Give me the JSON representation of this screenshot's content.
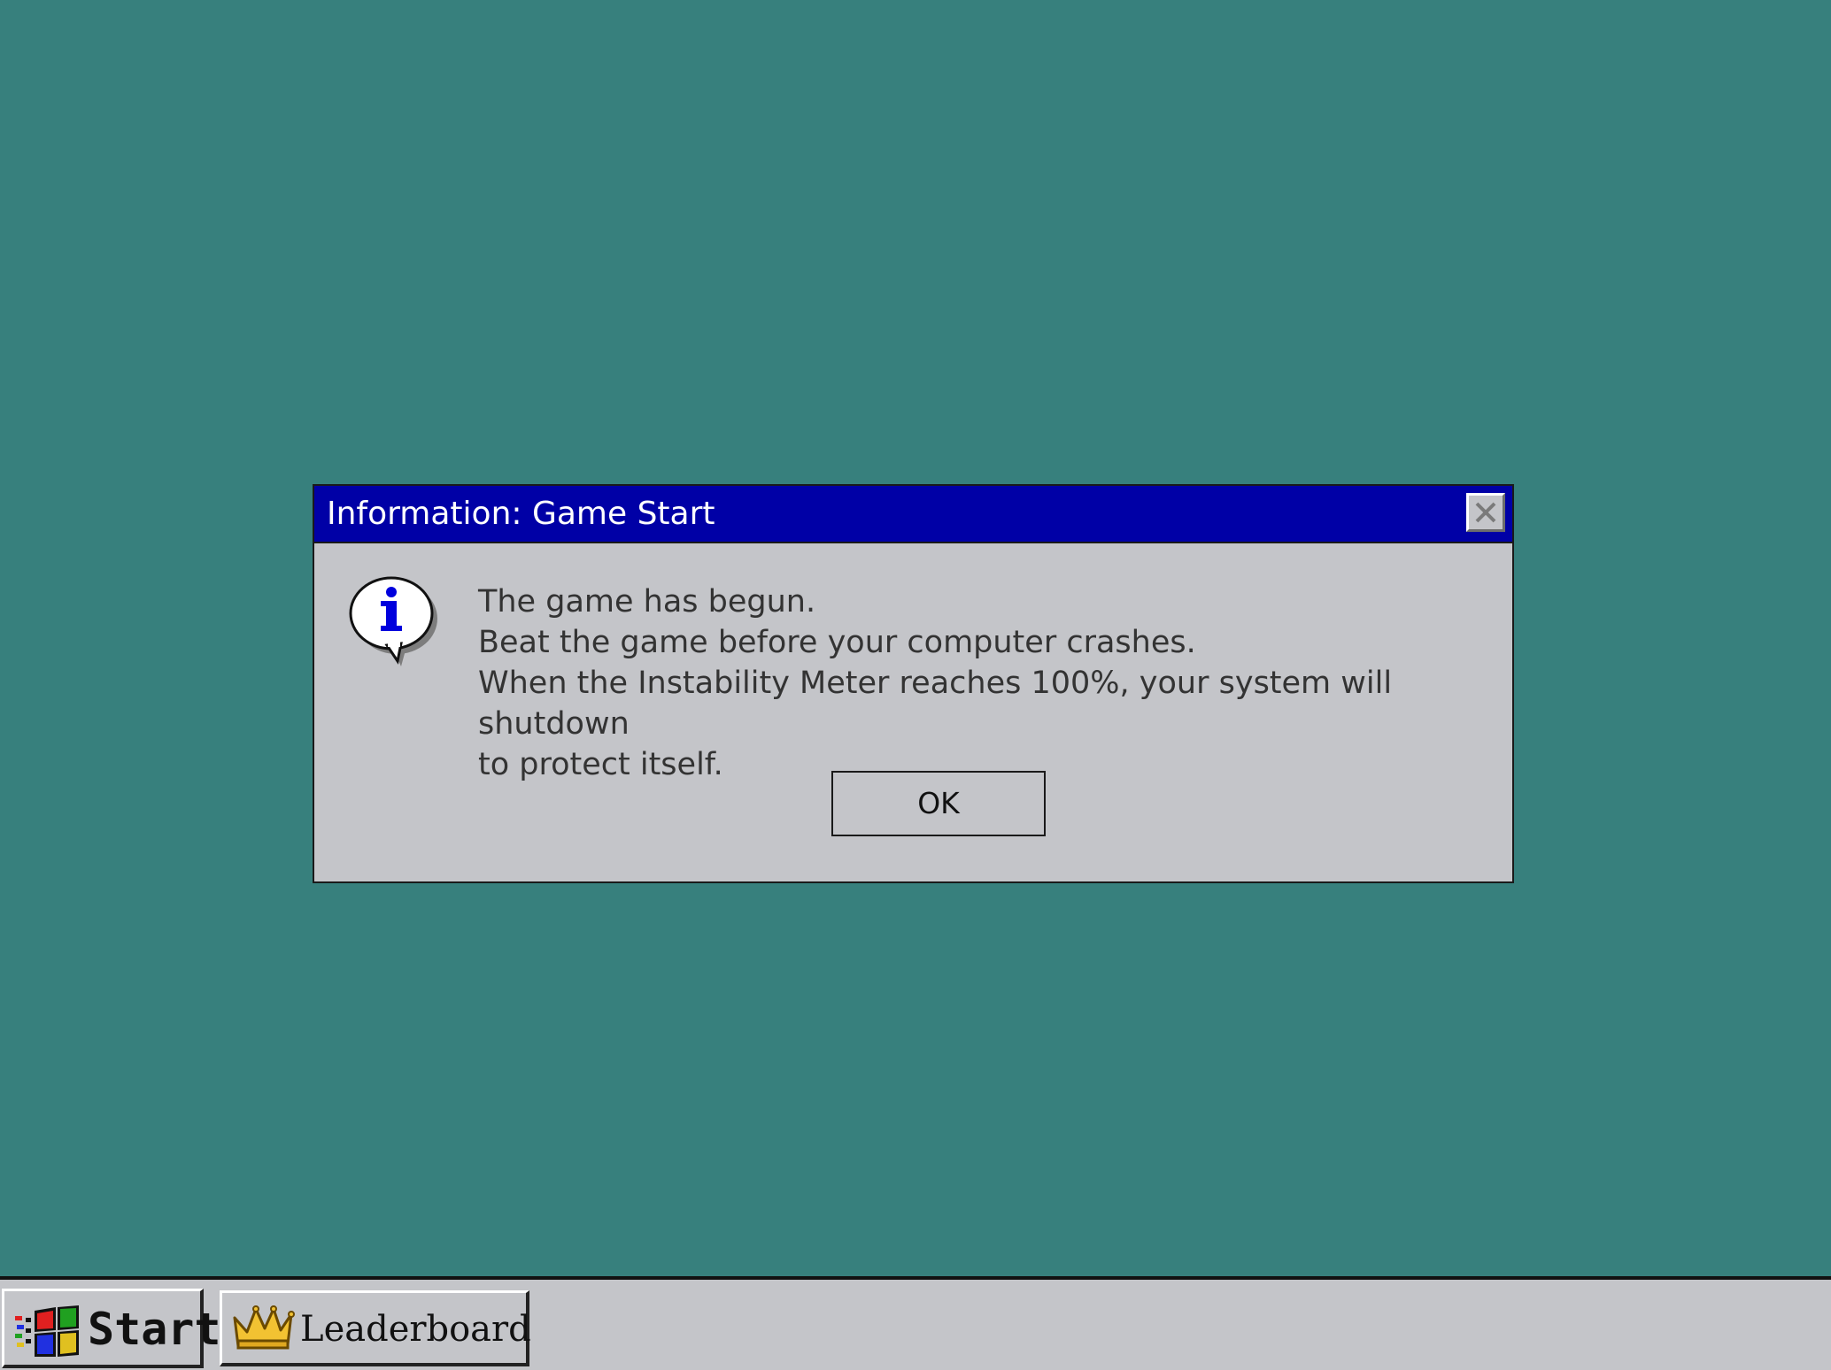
{
  "desktop": {
    "background_color": "#37807d"
  },
  "dialog": {
    "title": "Information: Game Start",
    "close_icon": "close-icon",
    "icon": "info-speech-bubble-icon",
    "message_lines": [
      "The game has begun.",
      "Beat the game before your computer crashes.",
      "When the Instability Meter reaches 100%, your system will shutdown",
      "to protect itself."
    ],
    "ok_label": "OK",
    "titlebar_color": "#0000a6",
    "body_color": "#c4c5c9"
  },
  "taskbar": {
    "start_label": "Start",
    "start_icon": "windows-flag-icon",
    "leaderboard_label": "Leaderboard",
    "leaderboard_icon": "crown-icon"
  }
}
